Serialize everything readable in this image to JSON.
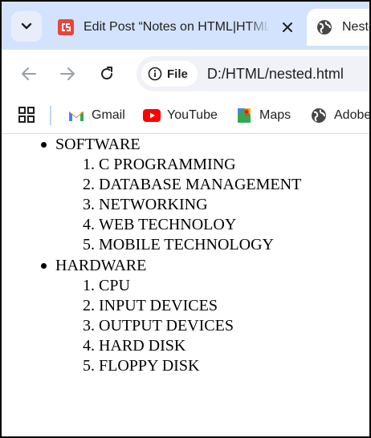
{
  "browser": {
    "tabs": [
      {
        "title": "Edit Post “Notes on HTML|HTML",
        "favicon": "cs-logo-icon",
        "active": false
      },
      {
        "title": "Neste",
        "favicon": "globe-icon",
        "active": true
      }
    ],
    "omnibox": {
      "chip_label": "File",
      "url": "D:/HTML/nested.html"
    },
    "bookmarks": [
      {
        "label": "Gmail",
        "icon": "gmail-icon"
      },
      {
        "label": "YouTube",
        "icon": "youtube-icon"
      },
      {
        "label": "Maps",
        "icon": "maps-icon"
      },
      {
        "label": "Adobe",
        "icon": "globe-icon"
      }
    ],
    "colors": {
      "tabstrip_bg": "#d3e3fd",
      "omnibox_bg": "#f0f2f7"
    }
  },
  "page": {
    "lists": [
      {
        "label": "SOFTWARE",
        "items": [
          {
            "num": "1.",
            "text": "C PROGRAMMING"
          },
          {
            "num": "2.",
            "text": "DATABASE MANAGEMENT"
          },
          {
            "num": "3.",
            "text": "NETWORKING"
          },
          {
            "num": "4.",
            "text": "WEB TECHNOLOY"
          },
          {
            "num": "5.",
            "text": "MOBILE TECHNOLOGY"
          }
        ]
      },
      {
        "label": "HARDWARE",
        "items": [
          {
            "num": "1.",
            "text": "CPU"
          },
          {
            "num": "2.",
            "text": "INPUT DEVICES"
          },
          {
            "num": "3.",
            "text": "OUTPUT DEVICES"
          },
          {
            "num": "4.",
            "text": "HARD DISK"
          },
          {
            "num": "5.",
            "text": "FLOPPY DISK"
          }
        ]
      }
    ]
  }
}
